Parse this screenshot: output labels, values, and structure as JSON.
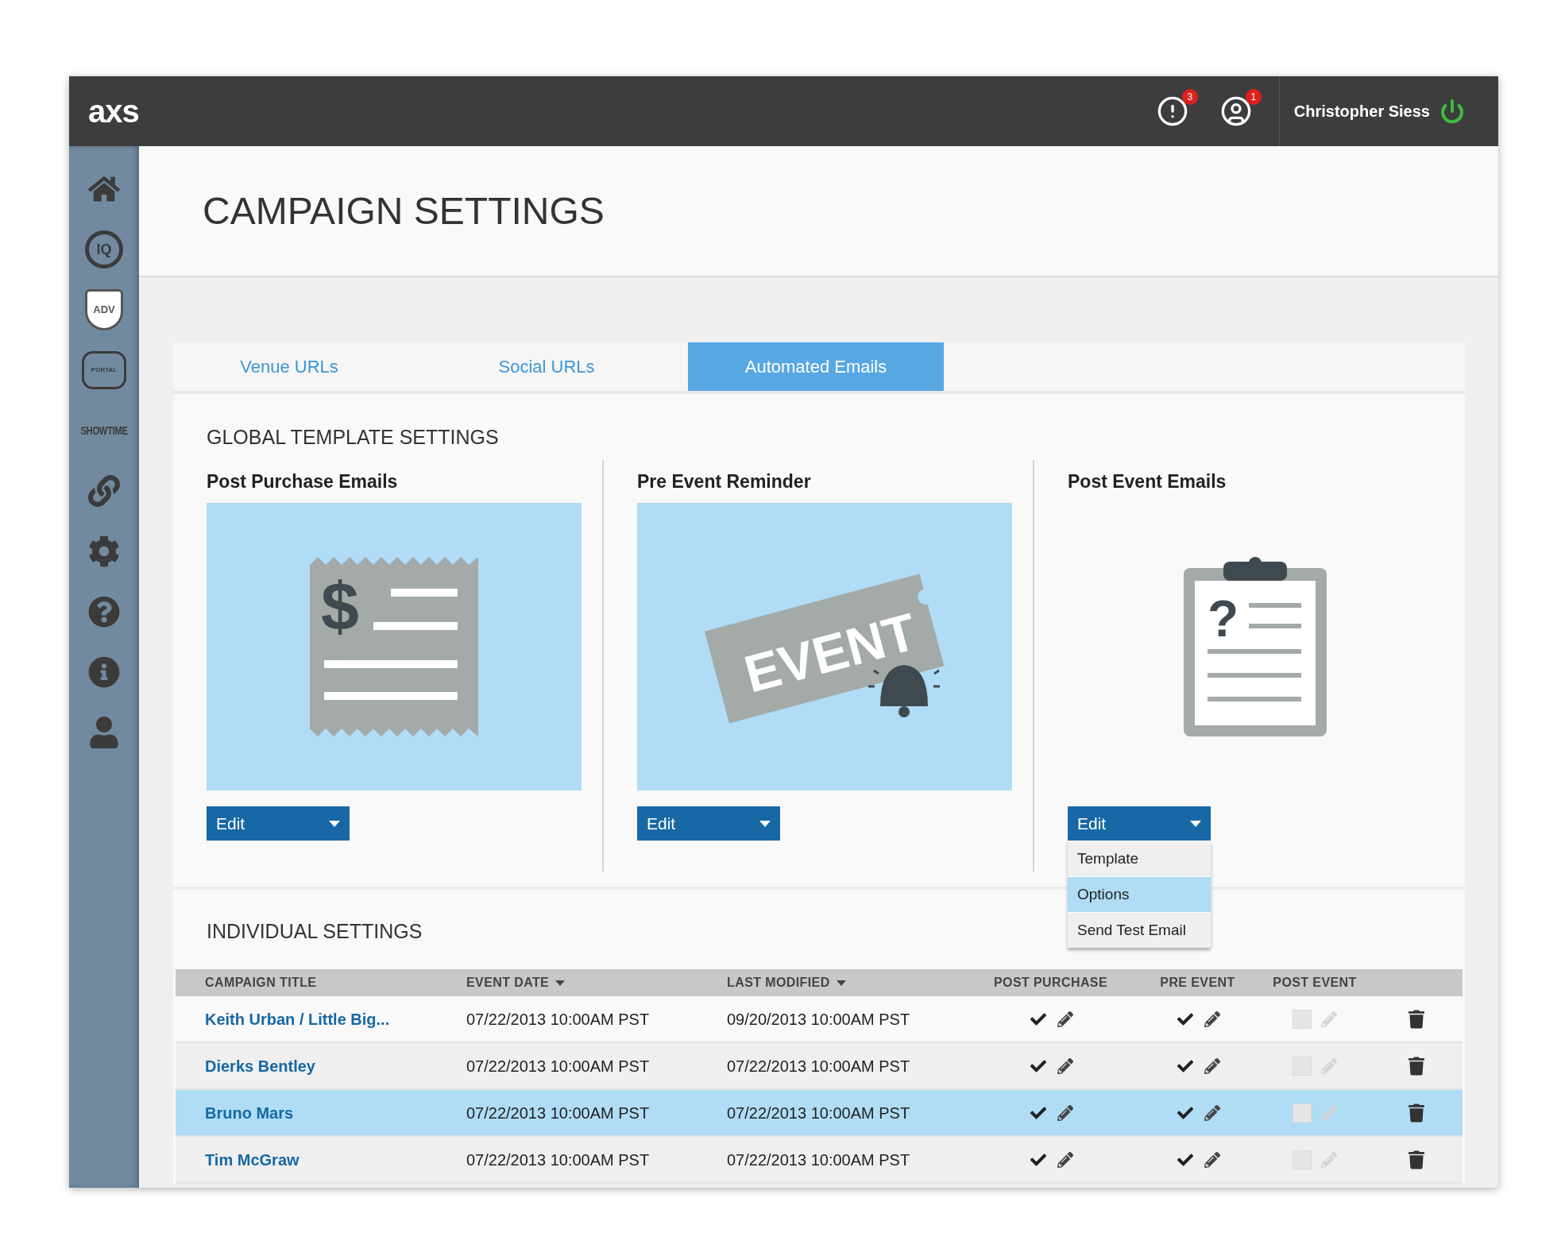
{
  "header": {
    "logo": "axs",
    "alerts_badge": "3",
    "users_badge": "1",
    "user_name": "Christopher Siess"
  },
  "sidebar": {
    "items": [
      {
        "kind": "home"
      },
      {
        "kind": "iq",
        "label": "IQ"
      },
      {
        "kind": "adv",
        "label": "ADV"
      },
      {
        "kind": "portal",
        "label": "PORTAL"
      },
      {
        "kind": "showtime",
        "label": "SHOWTIME"
      },
      {
        "kind": "link"
      },
      {
        "kind": "gear"
      },
      {
        "kind": "help"
      },
      {
        "kind": "info"
      },
      {
        "kind": "user"
      }
    ]
  },
  "page_title": "CAMPAIGN SETTINGS",
  "tabs": [
    {
      "label": "Venue URLs",
      "selected": false
    },
    {
      "label": "Social URLs",
      "selected": false
    },
    {
      "label": "Automated Emails",
      "selected": true
    }
  ],
  "global_settings": {
    "heading": "GLOBAL TEMPLATE SETTINGS",
    "cards": [
      {
        "title": "Post Purchase Emails",
        "kind": "receipt",
        "symbol": "$",
        "highlighted": true,
        "edit": {
          "label": "Edit"
        }
      },
      {
        "title": "Pre Event Reminder",
        "kind": "ticket",
        "symbol": "EVENT",
        "highlighted": true,
        "edit": {
          "label": "Edit"
        }
      },
      {
        "title": "Post Event Emails",
        "kind": "clipboard",
        "symbol": "?",
        "highlighted": false,
        "edit": {
          "label": "Edit",
          "menu": [
            {
              "label": "Template",
              "selected": false
            },
            {
              "label": "Options",
              "selected": true
            },
            {
              "label": "Send Test Email",
              "selected": false
            }
          ]
        }
      }
    ]
  },
  "individual_settings": {
    "heading": "INDIVIDUAL SETTINGS",
    "columns": [
      {
        "label": "CAMPAIGN TITLE"
      },
      {
        "label": "EVENT DATE",
        "sort": true
      },
      {
        "label": "LAST MODIFIED",
        "sort": true
      },
      {
        "label": "POST PURCHASE"
      },
      {
        "label": "PRE EVENT"
      },
      {
        "label": "POST EVENT"
      }
    ],
    "rows": [
      {
        "title": "Keith Urban / Little Big...",
        "event_date": "07/22/2013 10:00AM PST",
        "last_modified": "09/20/2013 10:00AM PST",
        "selected": false,
        "post_purchase": {
          "checked": true,
          "disabled": false
        },
        "pre_event": {
          "checked": true,
          "disabled": false
        },
        "post_event": {
          "checked": false,
          "disabled": true
        }
      },
      {
        "title": "Dierks Bentley",
        "event_date": "07/22/2013 10:00AM PST",
        "last_modified": "07/22/2013 10:00AM PST",
        "selected": false,
        "post_purchase": {
          "checked": true,
          "disabled": false
        },
        "pre_event": {
          "checked": true,
          "disabled": false
        },
        "post_event": {
          "checked": false,
          "disabled": true
        }
      },
      {
        "title": "Bruno Mars",
        "event_date": "07/22/2013 10:00AM PST",
        "last_modified": "07/22/2013 10:00AM PST",
        "selected": true,
        "post_purchase": {
          "checked": true,
          "disabled": false
        },
        "pre_event": {
          "checked": true,
          "disabled": false
        },
        "post_event": {
          "checked": false,
          "disabled": true
        }
      },
      {
        "title": "Tim McGraw",
        "event_date": "07/22/2013 10:00AM PST",
        "last_modified": "07/22/2013 10:00AM PST",
        "selected": false,
        "post_purchase": {
          "checked": true,
          "disabled": false
        },
        "pre_event": {
          "checked": true,
          "disabled": false
        },
        "post_event": {
          "checked": false,
          "disabled": true
        }
      }
    ]
  }
}
